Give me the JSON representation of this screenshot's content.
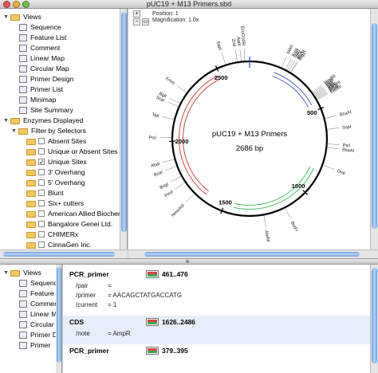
{
  "window": {
    "title": "pUC19 + M13 Primers.sbd"
  },
  "status": {
    "position": "Position: 1",
    "magnification": "Magnification: 1.0x"
  },
  "sidebar": {
    "items": [
      {
        "label": "Views",
        "kind": "folder-open",
        "indent": 0
      },
      {
        "label": "Sequence",
        "kind": "view",
        "icon": "sequence-icon",
        "indent": 1
      },
      {
        "label": "Feature List",
        "kind": "view",
        "icon": "feature-list-icon",
        "indent": 1
      },
      {
        "label": "Comment",
        "kind": "view",
        "icon": "comment-icon",
        "indent": 1
      },
      {
        "label": "Linear Map",
        "kind": "view",
        "icon": "linear-map-icon",
        "indent": 1
      },
      {
        "label": "Circular Map",
        "kind": "view",
        "icon": "circular-map-icon",
        "indent": 1
      },
      {
        "label": "Primer Design",
        "kind": "view",
        "icon": "primer-design-icon",
        "indent": 1
      },
      {
        "label": "Primer List",
        "kind": "view",
        "icon": "primer-list-icon",
        "indent": 1
      },
      {
        "label": "Minimap",
        "kind": "view",
        "icon": "minimap-icon",
        "indent": 1
      },
      {
        "label": "Site Summary",
        "kind": "view",
        "icon": "site-summary-icon",
        "indent": 1
      },
      {
        "label": "Enzymes Displayed",
        "kind": "folder-open",
        "indent": 0
      },
      {
        "label": "Filter by Selectors",
        "kind": "folder-open",
        "indent": 1
      },
      {
        "label": "Absent Sites",
        "kind": "check",
        "checked": false,
        "indent": 2
      },
      {
        "label": "Unique or Absent Sites",
        "kind": "check",
        "checked": false,
        "indent": 2
      },
      {
        "label": "Unique Sites",
        "kind": "check",
        "checked": true,
        "indent": 2
      },
      {
        "label": "3' Overhang",
        "kind": "check",
        "checked": false,
        "indent": 2
      },
      {
        "label": "5' Overhang",
        "kind": "check",
        "checked": false,
        "indent": 2
      },
      {
        "label": "Blunt",
        "kind": "check",
        "checked": false,
        "indent": 2
      },
      {
        "label": "Six+ cutters",
        "kind": "check",
        "checked": false,
        "indent": 2
      },
      {
        "label": "American Allied Biochemical",
        "kind": "check",
        "checked": false,
        "indent": 2
      },
      {
        "label": "Bangalore Genei Ltd.",
        "kind": "check",
        "checked": false,
        "indent": 2
      },
      {
        "label": "CHIMERx",
        "kind": "check",
        "checked": false,
        "indent": 2
      },
      {
        "label": "CinnaGen Inc.",
        "kind": "check",
        "checked": false,
        "indent": 2
      }
    ]
  },
  "bottom_sidebar": {
    "items": [
      {
        "label": "Views",
        "kind": "folder-open"
      },
      {
        "label": "Sequence",
        "icon": "sequence-icon"
      },
      {
        "label": "Feature",
        "icon": "feature-list-icon"
      },
      {
        "label": "Commen",
        "icon": "comment-icon"
      },
      {
        "label": "Linear M",
        "icon": "linear-map-icon"
      },
      {
        "label": "Circular",
        "icon": "circular-map-icon"
      },
      {
        "label": "Primer D",
        "icon": "primer-design-icon"
      },
      {
        "label": "Primer",
        "icon": "primer-list-icon"
      }
    ]
  },
  "map": {
    "title": "pUC19 + M13 Primers",
    "size": "2686 bp",
    "ticks": [
      "500",
      "1000",
      "1500",
      "2000",
      "2500"
    ],
    "labels": [
      {
        "text": "SapI"
      },
      {
        "text": "ZraI"
      },
      {
        "text": "AatII"
      },
      {
        "text": "EcoO109I"
      },
      {
        "text": "NdeI"
      },
      {
        "text": "KasI"
      },
      {
        "text": "NarI"
      },
      {
        "text": "SfoI"
      },
      {
        "text": "PluTI"
      },
      {
        "text": "BtgZI"
      },
      {
        "text": "HindIII"
      },
      {
        "text": "SphI"
      },
      {
        "text": "PstI"
      },
      {
        "text": "SalI"
      },
      {
        "text": "XbaI"
      },
      {
        "text": "BamHI"
      },
      {
        "text": "SmaI"
      },
      {
        "text": "KpnI"
      },
      {
        "text": "EcoRI"
      },
      {
        "text": "BsaXI"
      },
      {
        "text": "XmnI"
      },
      {
        "text": "BglI"
      },
      {
        "text": "ScaI"
      },
      {
        "text": "TatI"
      },
      {
        "text": "PciI"
      },
      {
        "text": "AhdI"
      },
      {
        "text": "BsaI"
      },
      {
        "text": "BcgI"
      },
      {
        "text": "PvuI"
      },
      {
        "text": "NmeAIII"
      },
      {
        "text": "AlwNI"
      },
      {
        "text": "BsrFI"
      },
      {
        "text": "DraI"
      },
      {
        "text": "BsaAI"
      },
      {
        "text": "PsiI"
      },
      {
        "text": "SspI"
      }
    ],
    "features": [
      {
        "name": "lacZα",
        "color": "#5560c8"
      },
      {
        "name": "AmpR",
        "color": "#d64545"
      },
      {
        "name": "ori",
        "color": "#4cc06a"
      }
    ],
    "colors": {
      "ring": "#000000",
      "ampr": "#d64545",
      "ori": "#4cc06a",
      "lac": "#5560c8",
      "cursor": "#1f5fbf"
    }
  },
  "features": [
    {
      "type": "PCR_primer",
      "range": "461..476",
      "qualifiers": [
        {
          "key": "/pair",
          "value": "="
        },
        {
          "key": "/primer",
          "value": "=  AACAGCTATGACCATG"
        },
        {
          "key": "/current",
          "value": "=  1"
        }
      ]
    },
    {
      "type": "CDS",
      "range": "1626..2486",
      "qualifiers": [
        {
          "key": "/note",
          "value": "=  AmpR"
        }
      ]
    },
    {
      "type": "PCR_primer",
      "range": "379..395",
      "qualifiers": []
    }
  ]
}
